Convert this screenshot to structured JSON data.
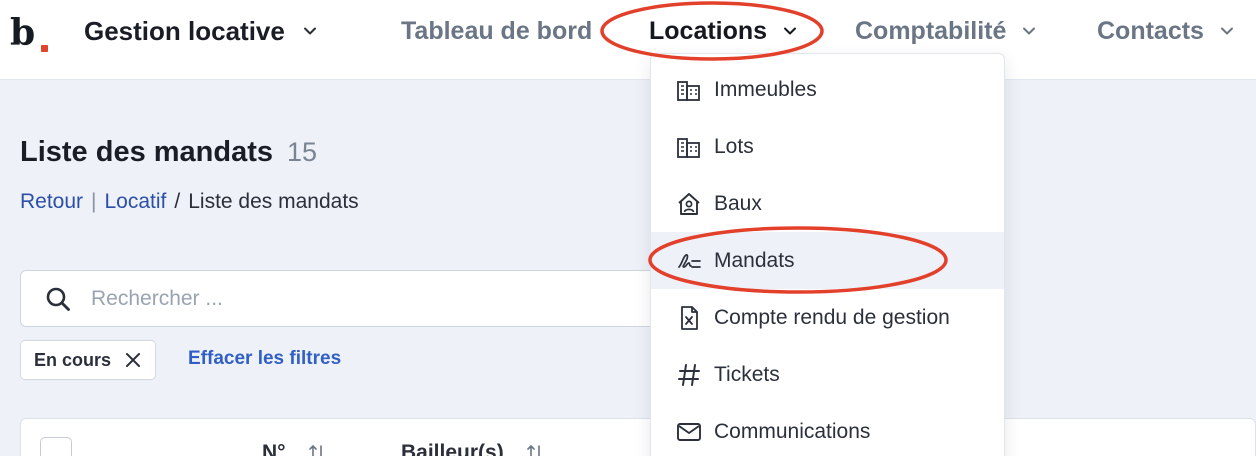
{
  "brand": {
    "logo_text": "b",
    "accent": "#e0452b"
  },
  "app_switcher": {
    "label": "Gestion locative"
  },
  "nav": {
    "items": [
      {
        "label": "Tableau de bord",
        "has_menu": false
      },
      {
        "label": "Locations",
        "has_menu": true,
        "active": true
      },
      {
        "label": "Comptabilité",
        "has_menu": true
      },
      {
        "label": "Contacts",
        "has_menu": true
      }
    ]
  },
  "locations_menu": {
    "items": [
      {
        "label": "Immeubles",
        "icon": "buildings-icon"
      },
      {
        "label": "Lots",
        "icon": "buildings-icon"
      },
      {
        "label": "Baux",
        "icon": "house-user-icon"
      },
      {
        "label": "Mandats",
        "icon": "signature-icon",
        "highlighted": true
      },
      {
        "label": "Compte rendu de gestion",
        "icon": "excel-file-icon"
      },
      {
        "label": "Tickets",
        "icon": "hash-icon"
      },
      {
        "label": "Communications",
        "icon": "envelope-icon"
      }
    ]
  },
  "page": {
    "title": "Liste des mandats",
    "count": "15",
    "breadcrumb": {
      "back": "Retour",
      "parent": "Locatif",
      "current": "Liste des mandats"
    }
  },
  "search": {
    "placeholder": "Rechercher ...",
    "value": ""
  },
  "filters": {
    "active": [
      {
        "label": "En cours"
      }
    ],
    "clear_label": "Effacer les filtres"
  },
  "table": {
    "columns": [
      {
        "label": "N°"
      },
      {
        "label": "Bailleur(s)"
      }
    ]
  },
  "annotation_color": "#e2402a"
}
